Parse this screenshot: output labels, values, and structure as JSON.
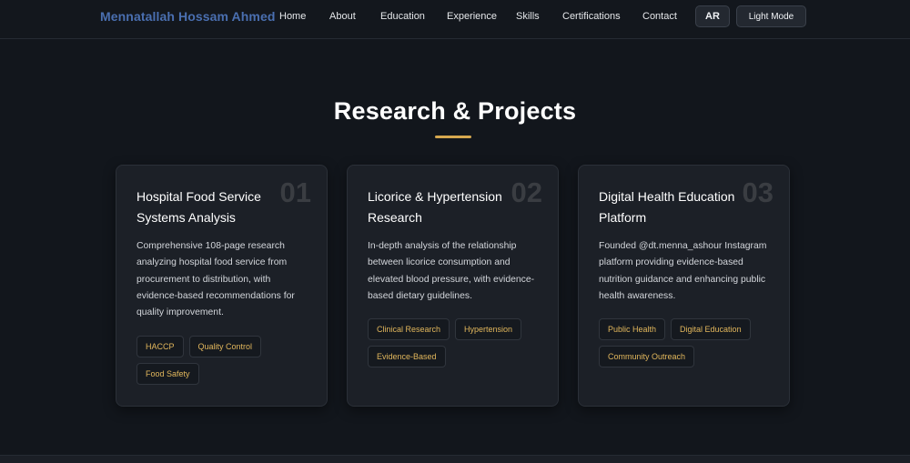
{
  "header": {
    "brand": "Mennatallah Hossam Ahmed",
    "nav": [
      "Home",
      "About",
      "Education",
      "Experience",
      "Skills",
      "Certifications",
      "Contact"
    ],
    "lang_button": "AR",
    "theme_button": "Light Mode"
  },
  "section": {
    "title": "Research & Projects",
    "accent_color": "#d6a84f"
  },
  "projects": [
    {
      "number": "01",
      "title": "Hospital Food Service Systems Analysis",
      "description": "Comprehensive 108-page research analyzing hospital food service from procurement to distribution, with evidence-based recommendations for quality improvement.",
      "tags": [
        "HACCP",
        "Quality Control",
        "Food Safety"
      ]
    },
    {
      "number": "02",
      "title": "Licorice & Hypertension Research",
      "description": "In-depth analysis of the relationship between licorice consumption and elevated blood pressure, with evidence-based dietary guidelines.",
      "tags": [
        "Clinical Research",
        "Hypertension",
        "Evidence-Based"
      ]
    },
    {
      "number": "03",
      "title": "Digital Health Education Platform",
      "description": "Founded @dt.menna_ashour Instagram platform providing evidence-based nutrition guidance and enhancing public health awareness.",
      "tags": [
        "Public Health",
        "Digital Education",
        "Community Outreach"
      ]
    }
  ]
}
